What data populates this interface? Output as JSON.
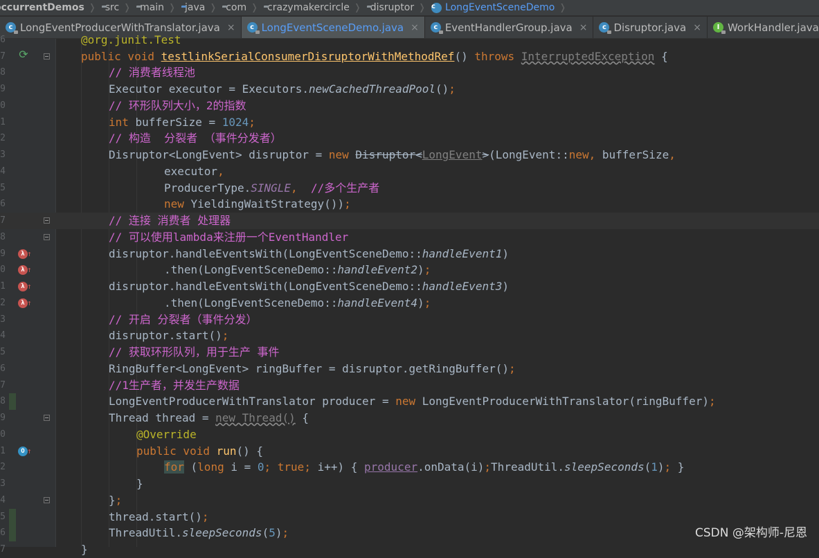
{
  "breadcrumb": {
    "items": [
      {
        "label": "occurrentDemos",
        "icon": "",
        "bold": true,
        "active": false
      },
      {
        "label": "src",
        "icon": "folder-icon",
        "bold": false,
        "active": false
      },
      {
        "label": "main",
        "icon": "folder-icon",
        "bold": false,
        "active": false
      },
      {
        "label": "java",
        "icon": "source-folder-icon",
        "bold": false,
        "active": false
      },
      {
        "label": "com",
        "icon": "package-icon",
        "bold": false,
        "active": false
      },
      {
        "label": "crazymakercircle",
        "icon": "package-icon",
        "bold": false,
        "active": false
      },
      {
        "label": "disruptor",
        "icon": "package-icon",
        "bold": false,
        "active": false
      },
      {
        "label": "LongEventSceneDemo",
        "icon": "class-icon",
        "bold": false,
        "active": true
      }
    ]
  },
  "tabs": [
    {
      "label": "LongEventProducerWithTranslator.java",
      "icon": "class-file-icon",
      "active": false,
      "close": "×"
    },
    {
      "label": "LongEventSceneDemo.java",
      "icon": "class-file-icon",
      "active": true,
      "close": "×"
    },
    {
      "label": "EventHandlerGroup.java",
      "icon": "class-file-icon",
      "active": false,
      "close": "×"
    },
    {
      "label": "Disruptor.java",
      "icon": "class-file-icon",
      "active": false,
      "close": "×"
    },
    {
      "label": "WorkHandler.java",
      "icon": "interface-file-icon",
      "active": false,
      "close": "×"
    }
  ],
  "editor": {
    "line_numbers": [
      "6",
      "7",
      "8",
      "9",
      "0",
      "1",
      "2",
      "3",
      "4",
      "5",
      "6",
      "7",
      "8",
      "9",
      "0",
      "1",
      "2",
      "3",
      "4",
      "5",
      "6",
      "7",
      "8",
      "9",
      "0",
      "1",
      "2",
      "3",
      "4",
      "5",
      "6",
      "7"
    ],
    "code": {
      "l0_annot": "@org.junit.Test",
      "l1_pv": "public void ",
      "l1_name": "testlinkSerialConsumerDisruptorWithMethodRef",
      "l1_paren": "() ",
      "l1_throws": "throws ",
      "l1_exc": "InterruptedException",
      "l1_brace": " {",
      "l2_comment": "// 消费者线程池",
      "l3_a": "Executor executor = Executors.",
      "l3_b": "newCachedThreadPool",
      "l3_c": "()",
      "l3_semi": ";",
      "l4_comment": "// 环形队列大小，2的指数",
      "l5_int": "int ",
      "l5_a": "bufferSize = ",
      "l5_num": "1024",
      "l5_semi": ";",
      "l6_comment": "// 构造  分裂者 （事件分发者）",
      "l7_a": "Disruptor<LongEvent> disruptor = ",
      "l7_new": "new ",
      "l7_dis": "Disruptor",
      "l7_lt": "<",
      "l7_le": "LongEvent",
      "l7_gt": ">",
      "l7_b": "(LongEvent::",
      "l7_new2": "new",
      "l7_comma": ", ",
      "l7_c": "bufferSize",
      "l7_comma2": ",",
      "l8_a": "executor",
      "l8_comma": ",",
      "l9_a": "ProducerType.",
      "l9_st": "SINGLE",
      "l9_comma": ",  ",
      "l9_comment": "//多个生产者",
      "l10_new": "new ",
      "l10_a": "YieldingWaitStrategy())",
      "l10_semi": ";",
      "l11_comment": "// 连接 消费者 处理器",
      "l12_comment": "// 可以使用lambda来注册一个EventHandler",
      "l13_a": "disruptor.handleEventsWith(LongEventSceneDemo::",
      "l13_fn": "handleEvent1",
      "l13_b": ")",
      "l14_a": ".then(LongEventSceneDemo::",
      "l14_fn": "handleEvent2",
      "l14_b": ")",
      "l14_semi": ";",
      "l15_a": "disruptor.handleEventsWith(LongEventSceneDemo::",
      "l15_fn": "handleEvent3",
      "l15_b": ")",
      "l16_a": ".then(LongEventSceneDemo::",
      "l16_fn": "handleEvent4",
      "l16_b": ")",
      "l16_semi": ";",
      "l17_comment": "// 开启 分裂者（事件分发）",
      "l18_a": "disruptor.start()",
      "l18_semi": ";",
      "l19_comment": "// 获取环形队列，用于生产 事件",
      "l20_a": "RingBuffer<LongEvent> ringBuffer = disruptor.getRingBuffer()",
      "l20_semi": ";",
      "l21_comment": "//1生产者，并发生产数据",
      "l22_a": "LongEventProducerWithTranslator producer = ",
      "l22_new": "new ",
      "l22_b": "LongEventProducerWithTranslator(ringBuffer)",
      "l22_semi": ";",
      "l23_a": "Thread thread = ",
      "l23_new": "new Thread()",
      "l23_b": " {",
      "l24_annot": "@Override",
      "l25_pv": "public void ",
      "l25_fn": "run",
      "l25_a": "() {",
      "l26_for": "for",
      "l26_a": " (",
      "l26_long": "long ",
      "l26_b": "i = ",
      "l26_zero": "0",
      "l26_semi1": "; ",
      "l26_true": "true",
      "l26_semi2": "; ",
      "l26_c": "i++) { ",
      "l26_prod": "producer",
      "l26_d": ".onData(i)",
      "l26_semi3": ";",
      "l26_e": "ThreadUtil.",
      "l26_sleep": "sleepSeconds",
      "l26_f": "(",
      "l26_one": "1",
      "l26_g": ")",
      "l26_semi4": "; ",
      "l26_h": "}",
      "l27_a": "}",
      "l28_a": "}",
      "l28_semi": ";",
      "l29_a": "thread.start()",
      "l29_semi": ";",
      "l30_a": "ThreadUtil.",
      "l30_sleep": "sleepSeconds",
      "l30_b": "(",
      "l30_five": "5",
      "l30_c": ")",
      "l30_semi": ";",
      "l31_a": "}"
    }
  },
  "watermark": "CSDN @架构师-尼恩",
  "colors": {
    "background": "#2b2b2b",
    "keyword": "#cc7832",
    "method": "#ffc66d",
    "comment": "#cc66cc",
    "number": "#6897bb",
    "static_field": "#9876aa",
    "annotation": "#bbb529",
    "active_tab_text": "#589df6"
  }
}
